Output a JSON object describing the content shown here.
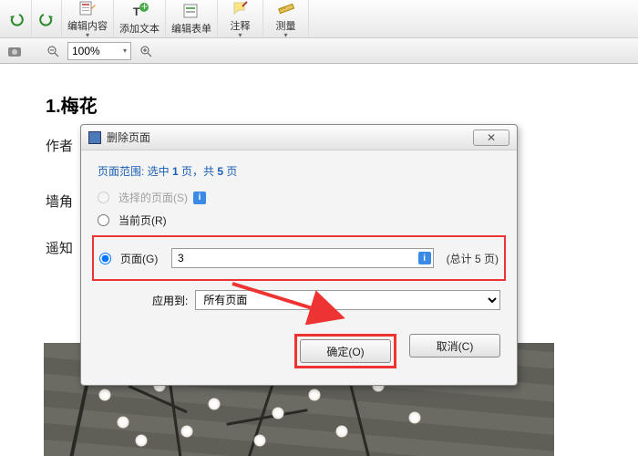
{
  "toolbar": {
    "zoom": "100%",
    "items": [
      {
        "label": "编辑内容"
      },
      {
        "label": "添加文本"
      },
      {
        "label": "编辑表单"
      },
      {
        "label": "注释"
      },
      {
        "label": "测量"
      }
    ]
  },
  "doc": {
    "title": "1.梅花",
    "line1": "作者",
    "line2": "墙角",
    "line3": "遥知"
  },
  "dialog": {
    "title": "删除页面",
    "range_prefix": "页面范围: 选中 ",
    "range_sel": "1",
    "range_mid": " 页，共 ",
    "range_total": "5",
    "range_suffix": " 页",
    "opt_selected": "选择的页面(S)",
    "opt_current": "当前页(R)",
    "opt_pages": "页面(G)",
    "page_value": "3",
    "total_label": "(总计 5 页)",
    "apply_label": "应用到:",
    "apply_value": "所有页面",
    "ok": "确定(O)",
    "cancel": "取消(C)",
    "close_x": "✕"
  }
}
